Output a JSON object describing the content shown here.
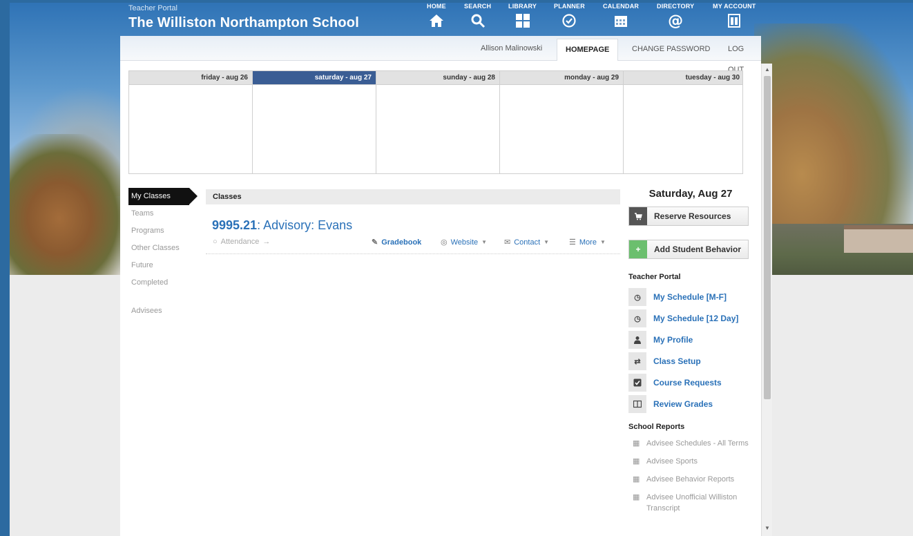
{
  "header": {
    "portal_label": "Teacher Portal",
    "school_name": "The Williston Northampton School",
    "nav": [
      {
        "label": "HOME",
        "icon": "home-icon"
      },
      {
        "label": "SEARCH",
        "icon": "search-icon"
      },
      {
        "label": "LIBRARY",
        "icon": "library-icon"
      },
      {
        "label": "PLANNER",
        "icon": "planner-icon"
      },
      {
        "label": "CALENDAR",
        "icon": "calendar-icon"
      },
      {
        "label": "DIRECTORY",
        "icon": "directory-icon"
      },
      {
        "label": "MY ACCOUNT",
        "icon": "account-icon"
      }
    ]
  },
  "toolbar": {
    "user_name": "Allison Malinowski",
    "tabs": [
      "HOMEPAGE",
      "CHANGE PASSWORD",
      "LOG OUT"
    ]
  },
  "calendar": {
    "days": [
      "friday - aug 26",
      "saturday - aug 27",
      "sunday - aug 28",
      "monday - aug 29",
      "tuesday - aug 30"
    ]
  },
  "leftnav": {
    "items": [
      "My Classes",
      "Teams",
      "Programs",
      "Other Classes",
      "Future",
      "Completed",
      "Advisees"
    ]
  },
  "classes": {
    "bar_title": "Classes",
    "class_code": "9995.21",
    "class_name": ": Advisory: Evans",
    "attendance": "Attendance",
    "gradebook": "Gradebook",
    "website": "Website",
    "contact": "Contact",
    "more": "More"
  },
  "right": {
    "date": "Saturday, Aug 27",
    "reserve": "Reserve Resources",
    "add_behavior": "Add Student Behavior",
    "teacher_portal_title": "Teacher Portal",
    "links": [
      "My Schedule [M-F]",
      "My Schedule [12 Day]",
      "My Profile",
      "Class Setup",
      "Course Requests",
      "Review Grades"
    ],
    "school_reports_title": "School Reports",
    "reports": [
      "Advisee Schedules - All Terms",
      "Advisee Sports",
      "Advisee Behavior Reports",
      "Advisee Unofficial Williston Transcript"
    ]
  }
}
